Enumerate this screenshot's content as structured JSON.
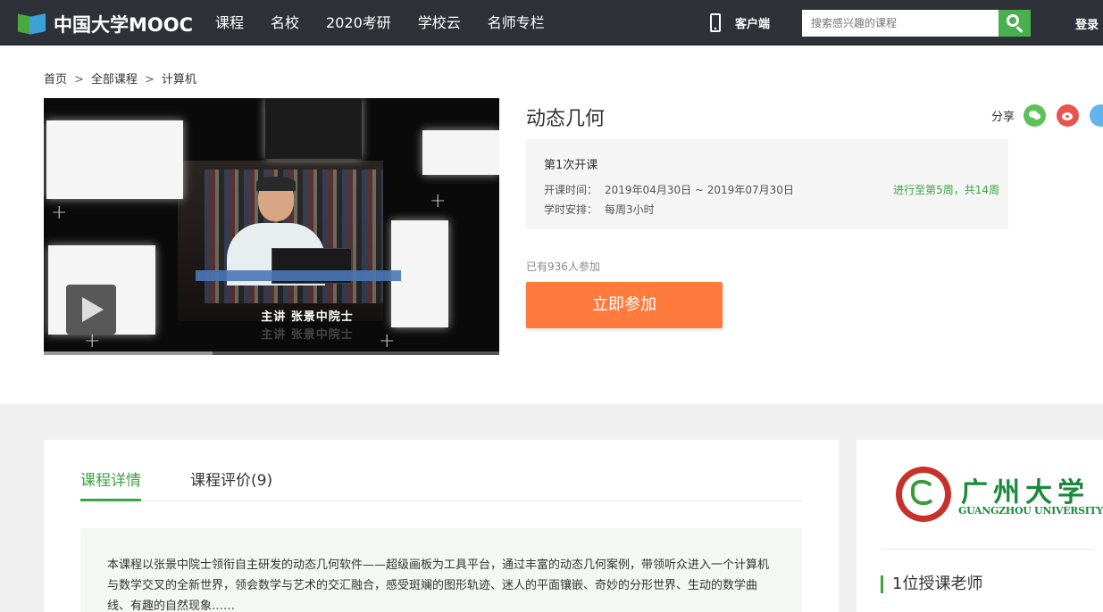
{
  "header": {
    "logo_text": "中国大学MOOC",
    "nav": [
      "课程",
      "名校",
      "2020考研",
      "学校云",
      "名师专栏"
    ],
    "client_label": "客户端",
    "search_placeholder": "搜索感兴趣的课程",
    "login_label": "登录"
  },
  "breadcrumb": [
    "首页",
    "全部课程",
    "计算机"
  ],
  "video": {
    "caption": "主讲 张景中院士",
    "nameplate": "主讲    张景中院士",
    "progress": 0.37
  },
  "course": {
    "title": "动态几何",
    "share_label": "分享",
    "session": {
      "name": "第1次开课",
      "time_label": "开课时间：",
      "time_value": "2019年04月30日 ~ 2019年07月30日",
      "progress": "进行至第5周，共14周",
      "hours_label": "学时安排：",
      "hours_value": "每周3小时"
    },
    "enrolled": "已有936人参加",
    "join_label": "立即参加"
  },
  "tabs": [
    "课程详情",
    "课程评价(9)"
  ],
  "description": "本课程以张景中院士领衔自主研发的动态几何软件——超级画板为工具平台，通过丰富的动态几何案例，带领听众进入一个计算机与数学交叉的全新世界，领会数学与艺术的交汇融合，感受斑斓的图形轨迹、迷人的平面镶嵌、奇妙的分形世界、生动的数学曲线、有趣的自然现象……",
  "university": {
    "name_cn": "广州大学",
    "name_en": "GUANGZHOU UNIVERSITY"
  },
  "teachers_title": "1位授课老师",
  "colors": {
    "nav_bg": "#2e3238",
    "accent_green": "#39a642",
    "join_orange": "#ff7a3d"
  }
}
